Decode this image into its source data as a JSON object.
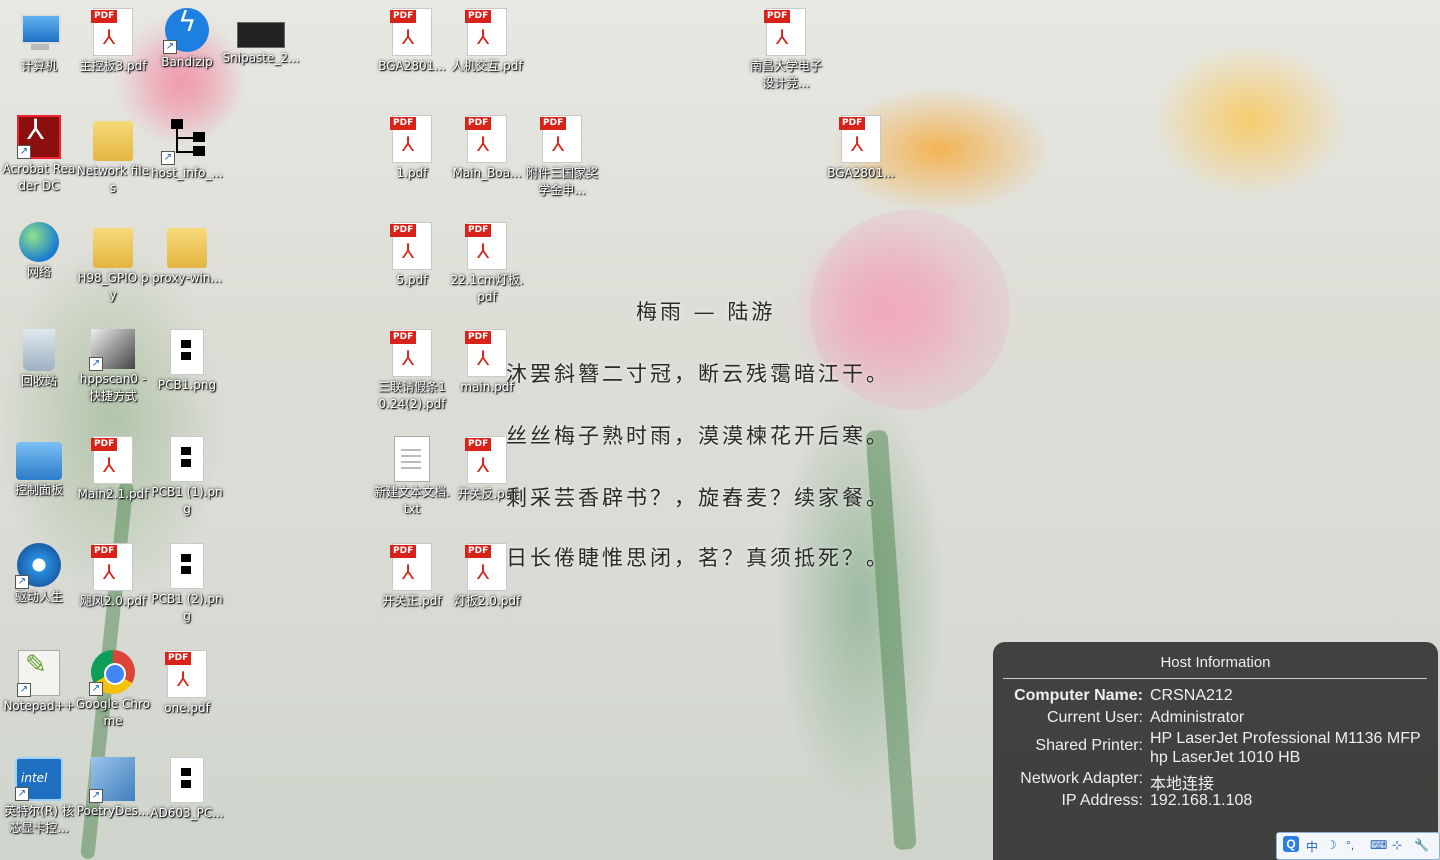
{
  "desktop": {
    "icons": [
      {
        "label": "计算机",
        "glyph": "computer-icon"
      },
      {
        "label": "主控板3.pdf",
        "glyph": "pdf-icon"
      },
      {
        "label": "Bandizip",
        "glyph": "bandizip-icon"
      },
      {
        "label": "Snipaste_2...",
        "glyph": "image-thumbnail-icon"
      },
      {
        "label": "BGA2801...",
        "glyph": "pdf-icon"
      },
      {
        "label": "人机交互.pdf",
        "glyph": "pdf-icon"
      },
      {
        "label": "南昌大学电子设计竞...",
        "glyph": "pdf-icon"
      },
      {
        "label": "Acrobat Reader DC",
        "glyph": "acrobat-icon"
      },
      {
        "label": "Network files",
        "glyph": "folder-icon"
      },
      {
        "label": "host_info_...",
        "glyph": "tree-diagram-icon"
      },
      {
        "label": "1.pdf",
        "glyph": "pdf-icon"
      },
      {
        "label": "Main_Boa...",
        "glyph": "pdf-icon"
      },
      {
        "label": "附件三国家奖学金申...",
        "glyph": "pdf-icon"
      },
      {
        "label": "BGA2801...",
        "glyph": "pdf-icon"
      },
      {
        "label": "网络",
        "glyph": "network-globe-icon"
      },
      {
        "label": "H98_GPIO py",
        "glyph": "folder-icon"
      },
      {
        "label": "proxy-win...",
        "glyph": "folder-icon"
      },
      {
        "label": "5.pdf",
        "glyph": "pdf-icon"
      },
      {
        "label": "22.1cm灯板.pdf",
        "glyph": "pdf-icon"
      },
      {
        "label": "回收站",
        "glyph": "recycle-bin-icon"
      },
      {
        "label": "hppscan0 - 快捷方式",
        "glyph": "scanner-icon"
      },
      {
        "label": "PCB1.png",
        "glyph": "png-file-icon"
      },
      {
        "label": "三联请假条10.24(2).pdf",
        "glyph": "pdf-icon"
      },
      {
        "label": "main.pdf",
        "glyph": "pdf-icon"
      },
      {
        "label": "控制面板",
        "glyph": "control-panel-icon"
      },
      {
        "label": "Main2.1.pdf",
        "glyph": "pdf-icon"
      },
      {
        "label": "PCB1 (1).png",
        "glyph": "png-file-icon"
      },
      {
        "label": "新建文本文档.txt",
        "glyph": "text-file-icon"
      },
      {
        "label": "开关反.pdf",
        "glyph": "pdf-icon"
      },
      {
        "label": "驱动人生",
        "glyph": "driver-gear-icon"
      },
      {
        "label": "飓风2.0.pdf",
        "glyph": "pdf-icon"
      },
      {
        "label": "PCB1 (2).png",
        "glyph": "png-file-icon"
      },
      {
        "label": "开关正.pdf",
        "glyph": "pdf-icon"
      },
      {
        "label": "灯板2.0.pdf",
        "glyph": "pdf-icon"
      },
      {
        "label": "Notepad++",
        "glyph": "notepadpp-icon"
      },
      {
        "label": "Google Chrome",
        "glyph": "chrome-icon"
      },
      {
        "label": "one.pdf",
        "glyph": "pdf-icon"
      },
      {
        "label": "英特尔(R) 核芯显卡控...",
        "glyph": "intel-graphics-icon"
      },
      {
        "label": "PoetryDes...",
        "glyph": "poetry-app-icon"
      },
      {
        "label": "AD603_PC...",
        "glyph": "png-file-icon"
      }
    ],
    "pdf_tag": "PDF"
  },
  "poem": {
    "title": "梅雨 — 陆游",
    "lines": [
      "沐罢斜簪二寸冠，断云残霭暗江干。",
      "丝丝梅子熟时雨，漠漠楝花开后寒。",
      "剩采芸香辟书？，旋舂麦？续家餐。",
      "日长倦睫惟思闭，茗？真须抵死？。"
    ]
  },
  "host_info": {
    "title": "Host Information",
    "computer_name_label": "Computer Name:",
    "computer_name": "CRSNA212",
    "current_user_label": "Current User:",
    "current_user": "Administrator",
    "shared_printer_label": "Shared Printer:",
    "shared_printer_1": "HP LaserJet Professional M1136 MFP",
    "shared_printer_2": "hp LaserJet 1010 HB",
    "network_adapter_label": "Network Adapter:",
    "network_adapter": "本地连接",
    "ip_address_label": "IP Address:",
    "ip_address": "192.168.1.108"
  },
  "ime_bar": {
    "logo": "Q",
    "mode": "中",
    "moon": "☽",
    "punct": "°,",
    "keyboard": "⌨",
    "extra": "⊹",
    "tool": "🔧"
  }
}
